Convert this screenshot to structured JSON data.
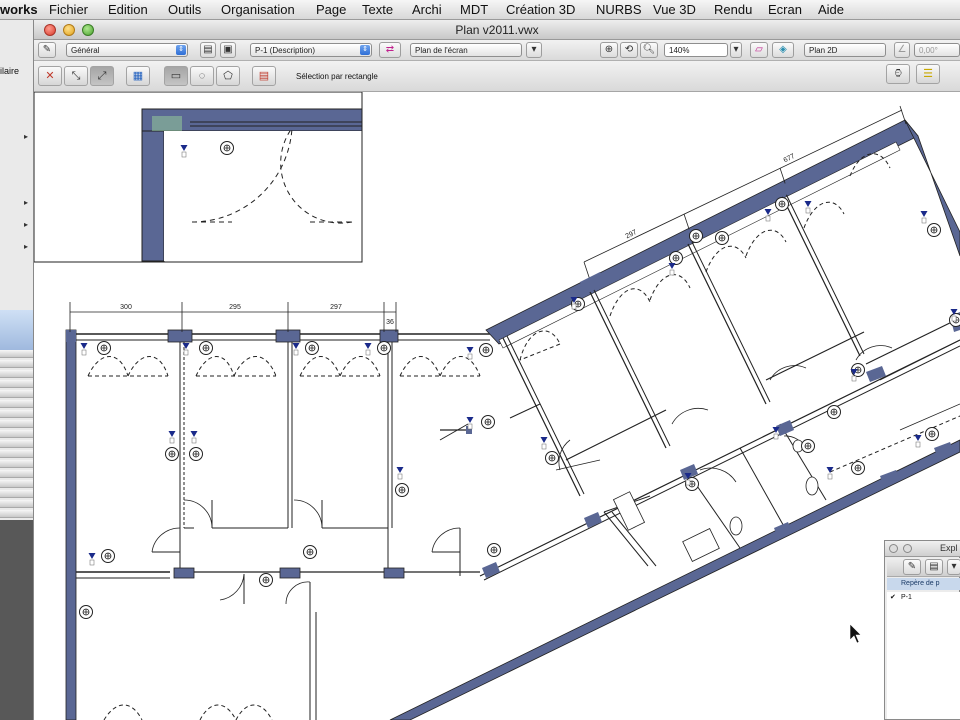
{
  "menubar": {
    "app": "works",
    "items": [
      "Fichier",
      "Edition",
      "Outils",
      "Organisation",
      "Page",
      "Texte",
      "Archi",
      "MDT",
      "Création 3D",
      "NURBS",
      "Vue 3D",
      "Rendu",
      "Ecran",
      "Aide"
    ]
  },
  "window": {
    "title": "Plan v2011.vwx"
  },
  "left_strip": {
    "label_partial": "ilaire"
  },
  "toolbar": {
    "class_popup": "Général",
    "layer_popup": "P-1 (Description)",
    "view_popup": "Plan de l'écran",
    "zoom": "140%",
    "projection_popup": "Plan 2D",
    "rotation": "0,00°",
    "mode_text": "Sélection par rectangle",
    "icons": [
      "class-icon",
      "layer-icon",
      "lens-icon",
      "zoom-icon",
      "view-icon",
      "rotate-icon",
      "alignment-icon",
      "selection-icon",
      "arrow-icon",
      "rectangle-icon",
      "lasso-icon",
      "polygon-icon"
    ]
  },
  "drawing": {
    "dimensions": [
      "300",
      "295",
      "297",
      "36",
      "297",
      "677"
    ]
  },
  "palette": {
    "title": "Expl",
    "header": "Repère de p",
    "row": "P-1",
    "check": "✔"
  },
  "colors": {
    "wall": "#5a6794",
    "line": "#222222",
    "marker": "#1a2a8a",
    "accent_blue": "#3b78e0"
  }
}
